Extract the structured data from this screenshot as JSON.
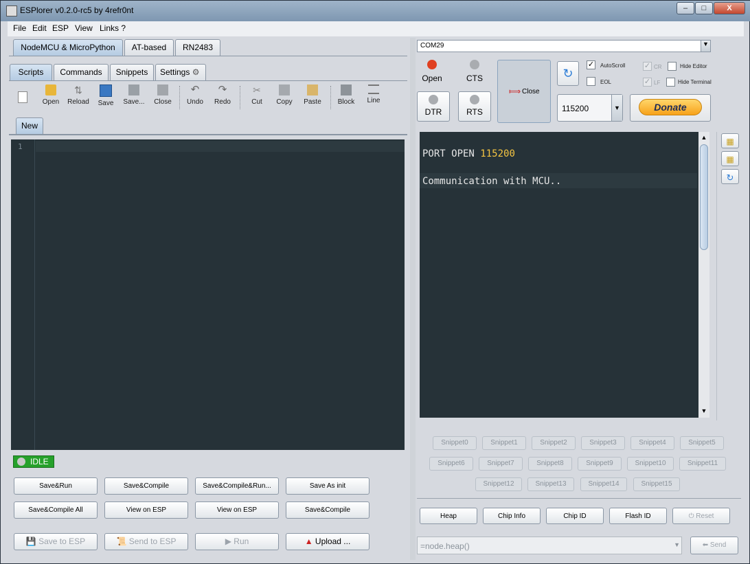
{
  "window": {
    "title": "ESPlorer v0.2.0-rc5 by 4refr0nt",
    "controls": [
      "–",
      "□",
      "X"
    ]
  },
  "menu": [
    "File",
    "Edit",
    "ESP",
    "View",
    "Links ?"
  ],
  "left": {
    "top_tabs": [
      "NodeMCU & MicroPython",
      "AT-based",
      "RN2483"
    ],
    "sub_tabs": [
      "Scripts",
      "Commands",
      "Snippets",
      "Settings"
    ],
    "toolbar": [
      "Open",
      "Reload",
      "Save",
      "Save...",
      "Close",
      "Undo",
      "Redo",
      "Cut",
      "Copy",
      "Paste",
      "Block",
      "Line"
    ],
    "file_tab": "New",
    "line_number": "1",
    "status": "IDLE",
    "buttons_row1": [
      "Save&Run",
      "Save&Compile",
      "Save&Compile&Run...",
      "Save As init"
    ],
    "buttons_row2": [
      "Save&Compile All",
      "View on ESP",
      "View on ESP",
      "Save&Compile"
    ],
    "bottom_buttons": [
      "Save to ESP",
      "Send to ESP",
      "Run",
      "Upload ..."
    ]
  },
  "right": {
    "port": "COM29",
    "open_label": "Open",
    "cts_label": "CTS",
    "dtr_label": "DTR",
    "rts_label": "RTS",
    "close_label": "Close",
    "baud": "115200",
    "donate": "Donate",
    "checkboxes": {
      "autoscroll": "AutoScroll",
      "eol": "EOL",
      "cr": "CR",
      "lf": "LF",
      "hide_editor": "Hide Editor",
      "hide_terminal": "Hide Terminal"
    },
    "terminal": {
      "line1_text": "PORT OPEN",
      "line1_value": "115200",
      "line2": "Communication with MCU.."
    },
    "snippets_row1": [
      "Snippet0",
      "Snippet1",
      "Snippet2",
      "Snippet3",
      "Snippet4",
      "Snippet5"
    ],
    "snippets_row2": [
      "Snippet6",
      "Snippet7",
      "Snippet8",
      "Snippet9",
      "Snippet10",
      "Snippet11"
    ],
    "snippets_row3": [
      "Snippet12",
      "Snippet13",
      "Snippet14",
      "Snippet15"
    ],
    "bottom_buttons": [
      "Heap",
      "Chip Info",
      "Chip ID",
      "Flash ID",
      "Reset"
    ],
    "command": "=node.heap()",
    "send": "Send"
  },
  "colors": {
    "editor_bg": "#263238",
    "terminal_text": "#e6e6e6",
    "terminal_value": "#f5c542",
    "idle_green": "#26a12b",
    "open_led": "#e04020",
    "donate_orange": "#f7a21a"
  }
}
